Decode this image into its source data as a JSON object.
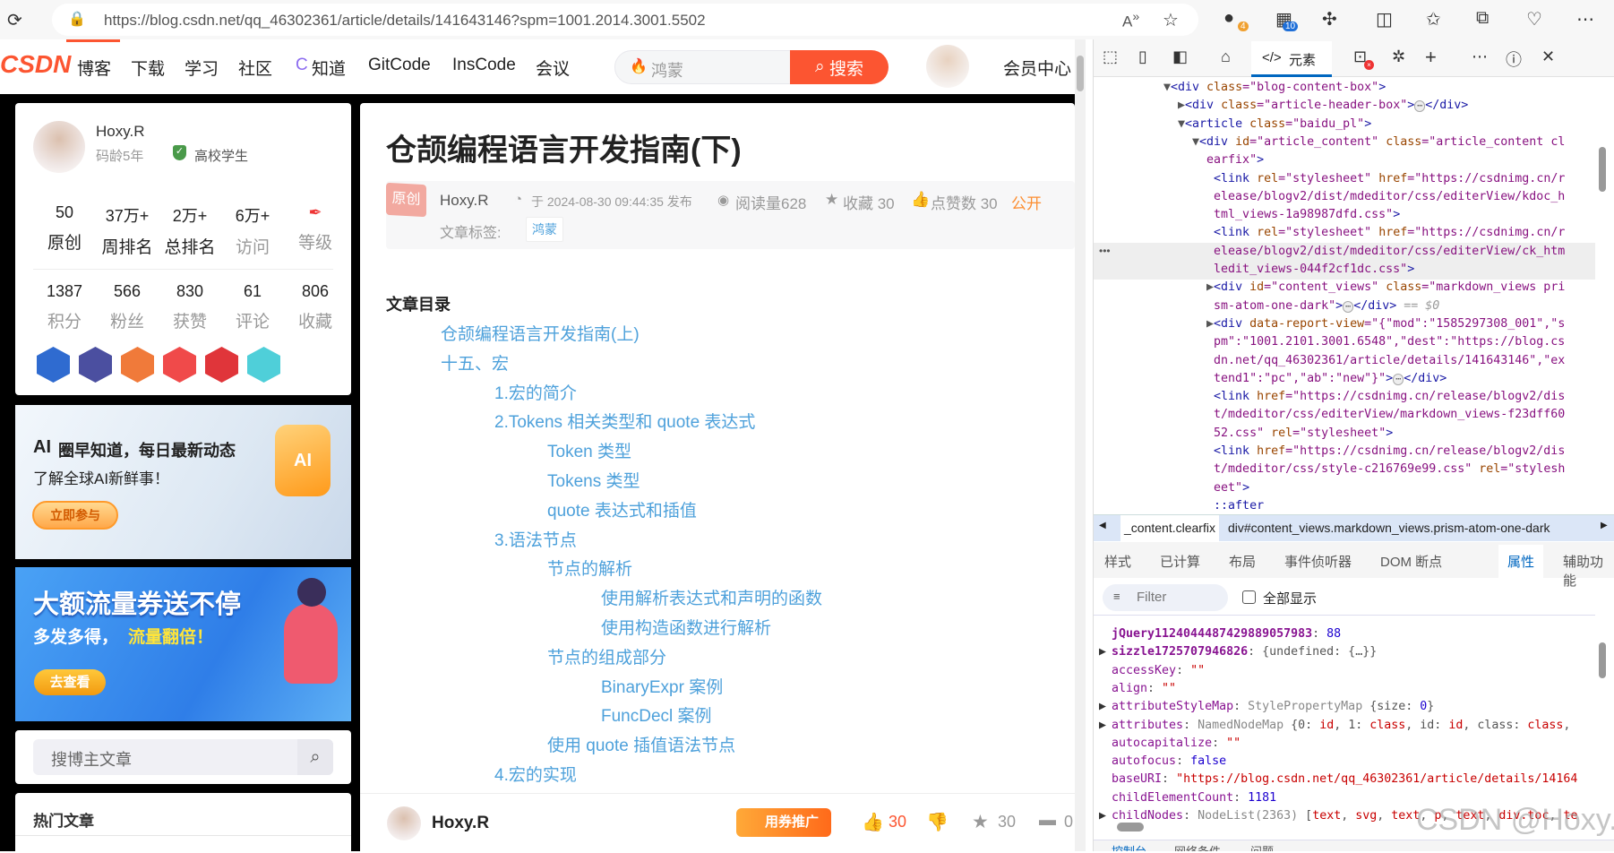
{
  "browser": {
    "url": "https://blog.csdn.net/qq_46302361/article/details/141643146?spm=1001.2014.3001.5502",
    "ext_badge_1": "4",
    "ext_badge_2": "10"
  },
  "nav": {
    "logo": "CSDN",
    "items": [
      "博客",
      "下载",
      "学习",
      "社区",
      "知道",
      "GitCode",
      "InsCode",
      "会议"
    ],
    "search_placeholder": "鸿蒙",
    "search_button": "搜索",
    "member": "会员中心"
  },
  "profile": {
    "name": "Hoxy.R",
    "code_age": "码龄5年",
    "verify": "高校学生",
    "stats1": [
      {
        "n": "50",
        "l": "原创"
      },
      {
        "n": "37万+",
        "l": "周排名"
      },
      {
        "n": "2万+",
        "l": "总排名"
      },
      {
        "n": "6万+",
        "l": "访问"
      },
      {
        "n": "",
        "l": "等级"
      }
    ],
    "stats2": [
      {
        "n": "1387",
        "l": "积分"
      },
      {
        "n": "566",
        "l": "粉丝"
      },
      {
        "n": "830",
        "l": "获赞"
      },
      {
        "n": "61",
        "l": "评论"
      },
      {
        "n": "806",
        "l": "收藏"
      }
    ],
    "badge_colors": [
      "#2f6bd0",
      "#4b4fa0",
      "#f07a3a",
      "#f04a4a",
      "#e0353a",
      "#4fcfd9"
    ]
  },
  "banner1": {
    "title": "圈早知道，每日最新动态",
    "ai": "AI",
    "subtitle": "了解全球AI新鲜事！",
    "button": "立即参与"
  },
  "banner2": {
    "title": "大额流量券送不停",
    "subtitle": "多发多得，",
    "highlight": "流量翻倍！",
    "button": "去查看"
  },
  "blog_search": {
    "placeholder": "搜博主文章"
  },
  "hot": {
    "title": "热门文章"
  },
  "article": {
    "title": "仓颉编程语言开发指南(下)",
    "type": "原创",
    "author": "Hoxy.R",
    "time": "于 2024-08-30 09:44:35 发布",
    "reads": "阅读量628",
    "favs": "收藏 30",
    "likes": "点赞数 30",
    "visibility": "公开",
    "tag_label": "文章标签:",
    "tags": [
      "鸿蒙"
    ],
    "toc_title": "文章目录",
    "toc": [
      {
        "t": "仓颉编程语言开发指南(上)",
        "lvl": 1
      },
      {
        "t": "十五、宏",
        "lvl": 1
      },
      {
        "t": "1.宏的简介",
        "lvl": 2
      },
      {
        "t": "2.Tokens 相关类型和 quote 表达式",
        "lvl": 2
      },
      {
        "t": "Token 类型",
        "lvl": 3
      },
      {
        "t": "Tokens 类型",
        "lvl": 3
      },
      {
        "t": "quote 表达式和插值",
        "lvl": 3
      },
      {
        "t": "3.语法节点",
        "lvl": 2
      },
      {
        "t": "节点的解析",
        "lvl": 3
      },
      {
        "t": "使用解析表达式和声明的函数",
        "lvl": 4
      },
      {
        "t": "使用构造函数进行解析",
        "lvl": 4
      },
      {
        "t": "节点的组成部分",
        "lvl": 3
      },
      {
        "t": "BinaryExpr 案例",
        "lvl": 4
      },
      {
        "t": "FuncDecl 案例",
        "lvl": 4
      },
      {
        "t": "使用 quote 插值语法节点",
        "lvl": 3
      },
      {
        "t": "4.宏的实现",
        "lvl": 2
      }
    ]
  },
  "bottom": {
    "author": "Hoxy.R",
    "promo": "用券推广",
    "likes": "30",
    "favs": "30",
    "comments": "0"
  },
  "devtools": {
    "tab_elements": "元素",
    "tree": [
      [
        [
          0,
          "▼"
        ],
        [
          1,
          "<div "
        ],
        [
          2,
          "class"
        ],
        [
          3,
          "=\"blog-content-box\""
        ],
        [
          1,
          ">"
        ]
      ],
      [
        [
          0,
          "  ▶"
        ],
        [
          1,
          "<div "
        ],
        [
          2,
          "class"
        ],
        [
          3,
          "=\"article-header-box\""
        ],
        [
          1,
          ">"
        ],
        [
          4,
          "⋯"
        ],
        [
          1,
          "</div>"
        ]
      ],
      [
        [
          0,
          "  ▼"
        ],
        [
          1,
          "<article "
        ],
        [
          2,
          "class"
        ],
        [
          3,
          "=\"baidu_pl\""
        ],
        [
          1,
          ">"
        ]
      ],
      [
        [
          0,
          "    ▼"
        ],
        [
          1,
          "<div "
        ],
        [
          2,
          "id"
        ],
        [
          3,
          "=\"article_content\" "
        ],
        [
          2,
          "class"
        ],
        [
          3,
          "=\"article_content cl"
        ]
      ],
      [
        [
          3,
          "      earfix\""
        ],
        [
          1,
          ">"
        ]
      ],
      [
        [
          1,
          "       <link "
        ],
        [
          2,
          "rel"
        ],
        [
          3,
          "=\"stylesheet\" "
        ],
        [
          2,
          "href"
        ],
        [
          3,
          "=\"https://csdnimg.cn/r"
        ]
      ],
      [
        [
          3,
          "       elease/blogv2/dist/mdeditor/css/editerView/kdoc_h"
        ]
      ],
      [
        [
          3,
          "       tml_views-1a98987dfd.css\""
        ],
        [
          1,
          ">"
        ]
      ],
      [
        [
          1,
          "       <link "
        ],
        [
          2,
          "rel"
        ],
        [
          3,
          "=\"stylesheet\" "
        ],
        [
          2,
          "href"
        ],
        [
          3,
          "=\"https://csdnimg.cn/r"
        ]
      ],
      [
        [
          3,
          "       elease/blogv2/dist/mdeditor/css/editerView/ck_htm"
        ]
      ],
      [
        [
          3,
          "       ledit_views-044f2cf1dc.css\""
        ],
        [
          1,
          ">"
        ]
      ],
      [
        [
          0,
          "      ▶"
        ],
        [
          1,
          "<div "
        ],
        [
          2,
          "id"
        ],
        [
          3,
          "=\"content_views\" "
        ],
        [
          2,
          "class"
        ],
        [
          3,
          "=\"markdown_views pri"
        ]
      ],
      [
        [
          3,
          "       sm-atom-one-dark\""
        ],
        [
          1,
          ">"
        ],
        [
          4,
          "⋯"
        ],
        [
          1,
          "</div>"
        ],
        [
          5,
          " == $0"
        ]
      ],
      [
        [
          0,
          "      ▶"
        ],
        [
          1,
          "<div "
        ],
        [
          2,
          "data-report-view"
        ],
        [
          3,
          "=\"{\"mod\":\"1585297308_001\",\"s"
        ]
      ],
      [
        [
          3,
          "       pm\":\"1001.2101.3001.6548\",\"dest\":\"https://blog.cs"
        ]
      ],
      [
        [
          3,
          "       dn.net/qq_46302361/article/details/141643146\",\"ex"
        ]
      ],
      [
        [
          3,
          "       tend1\":\"pc\",\"ab\":\"new\"}\""
        ],
        [
          1,
          ">"
        ],
        [
          4,
          "⋯"
        ],
        [
          1,
          "</div>"
        ]
      ],
      [
        [
          1,
          "       <link "
        ],
        [
          2,
          "href"
        ],
        [
          3,
          "=\"https://csdnimg.cn/release/blogv2/dis"
        ]
      ],
      [
        [
          3,
          "       t/mdeditor/css/editerView/markdown_views-f23dff60"
        ]
      ],
      [
        [
          3,
          "       52.css\" "
        ],
        [
          2,
          "rel"
        ],
        [
          3,
          "=\"stylesheet\""
        ],
        [
          1,
          ">"
        ]
      ],
      [
        [
          1,
          "       <link "
        ],
        [
          2,
          "href"
        ],
        [
          3,
          "=\"https://csdnimg.cn/release/blogv2/dis"
        ]
      ],
      [
        [
          3,
          "       t/mdeditor/css/style-c216769e99.css\" "
        ],
        [
          2,
          "rel"
        ],
        [
          3,
          "=\"stylesh"
        ]
      ],
      [
        [
          3,
          "       eet\""
        ],
        [
          1,
          ">"
        ]
      ],
      [
        [
          1,
          "       ::after"
        ]
      ]
    ],
    "breadcrumb": [
      "_content.clearfix",
      "div#content_views.markdown_views.prism-atom-one-dark"
    ],
    "subtabs": [
      "样式",
      "已计算",
      "布局",
      "事件侦听器",
      "DOM 断点",
      "属性",
      "辅助功能"
    ],
    "active_subtab": "属性",
    "filter_placeholder": "Filter",
    "show_all": "全部显示",
    "props": [
      [
        [
          0,
          " "
        ],
        [
          7,
          "jQuery112404448742988905798​3"
        ],
        [
          2,
          ": "
        ],
        [
          9,
          "88"
        ]
      ],
      [
        [
          0,
          "▶"
        ],
        [
          7,
          "sizzle1725707946826"
        ],
        [
          2,
          ": {undefined: {…}}"
        ]
      ],
      [
        [
          0,
          " "
        ],
        [
          6,
          "accessKey"
        ],
        [
          2,
          ": "
        ],
        [
          8,
          "\"\""
        ]
      ],
      [
        [
          0,
          " "
        ],
        [
          6,
          "align"
        ],
        [
          2,
          ": "
        ],
        [
          8,
          "\"\""
        ]
      ],
      [
        [
          0,
          "▶"
        ],
        [
          6,
          "attributeStyleMap"
        ],
        [
          2,
          ": "
        ],
        [
          3,
          "StylePropertyMap "
        ],
        [
          2,
          "{size: "
        ],
        [
          9,
          "0"
        ],
        [
          2,
          "}"
        ]
      ],
      [
        [
          0,
          "▶"
        ],
        [
          6,
          "attributes"
        ],
        [
          2,
          ": "
        ],
        [
          3,
          "NamedNodeMap "
        ],
        [
          2,
          "{0: "
        ],
        [
          8,
          "id"
        ],
        [
          2,
          ", 1: "
        ],
        [
          8,
          "class"
        ],
        [
          2,
          ", id: "
        ],
        [
          8,
          "id"
        ],
        [
          2,
          ", class: "
        ],
        [
          8,
          "class"
        ],
        [
          2,
          ","
        ]
      ],
      [
        [
          0,
          " "
        ],
        [
          6,
          "autocapitalize"
        ],
        [
          2,
          ": "
        ],
        [
          8,
          "\"\""
        ]
      ],
      [
        [
          0,
          " "
        ],
        [
          6,
          "autofocus"
        ],
        [
          2,
          ": "
        ],
        [
          9,
          "false"
        ]
      ],
      [
        [
          0,
          " "
        ],
        [
          6,
          "baseURI"
        ],
        [
          2,
          ": "
        ],
        [
          8,
          "\"https://blog.csdn.net/qq_46302361/article/details/14164"
        ]
      ],
      [
        [
          0,
          " "
        ],
        [
          6,
          "childElementCount"
        ],
        [
          2,
          ": "
        ],
        [
          9,
          "1181"
        ]
      ],
      [
        [
          0,
          "▶"
        ],
        [
          6,
          "childNodes"
        ],
        [
          2,
          ": "
        ],
        [
          3,
          "NodeList(2363) "
        ],
        [
          2,
          "["
        ],
        [
          8,
          "text"
        ],
        [
          2,
          ", "
        ],
        [
          8,
          "svg"
        ],
        [
          2,
          ", "
        ],
        [
          8,
          "text"
        ],
        [
          2,
          ", "
        ],
        [
          8,
          "p"
        ],
        [
          2,
          ", "
        ],
        [
          8,
          "text"
        ],
        [
          2,
          ", "
        ],
        [
          8,
          "div.toc"
        ],
        [
          2,
          ", "
        ],
        [
          8,
          "te"
        ]
      ]
    ],
    "drawer_tabs": [
      "控制台",
      "网络条件",
      "问题"
    ]
  },
  "watermark": "CSDN @Hoxy.R",
  "colors": {
    "accent": "#fc5531",
    "link": "#4ea1db",
    "devtools_active": "#0067c0"
  }
}
